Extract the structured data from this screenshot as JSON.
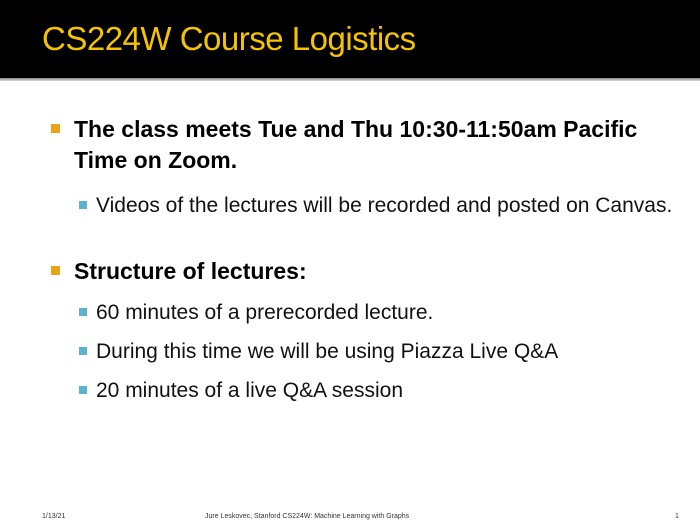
{
  "title": "CS224W Course Logistics",
  "bullets": [
    {
      "text": "The class meets Tue and Thu 10:30-11:50am Pacific Time on Zoom.",
      "sub": [
        "Videos of the lectures will be recorded and posted on Canvas."
      ]
    },
    {
      "text": "Structure of lectures:",
      "sub": [
        "60 minutes of a prerecorded lecture.",
        "During this time we will be using Piazza Live Q&A",
        "20 minutes of a live Q&A session"
      ]
    }
  ],
  "footer": {
    "date": "1/13/21",
    "center": "Jure Leskovec, Stanford CS224W: Machine Learning with Graphs",
    "page": "1"
  },
  "colors": {
    "title": "#F5C400",
    "header_bg": "#000000",
    "bullet1": "#E8A317",
    "bullet2": "#5DB3CF"
  }
}
